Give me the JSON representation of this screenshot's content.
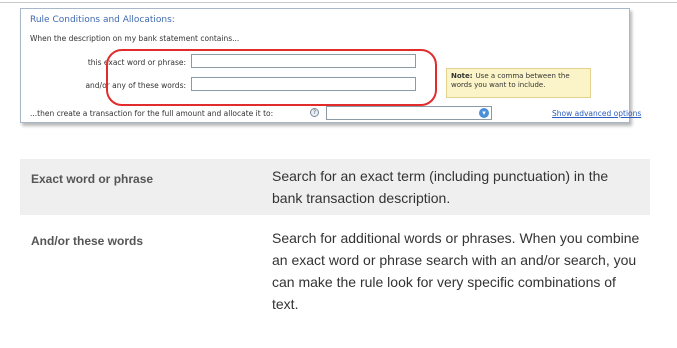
{
  "panel": {
    "heading": "Rule Conditions and Allocations:",
    "intro": "When the description on my bank statement contains...",
    "exact_label": "this exact word or phrase:",
    "any_label": "and/or any of these words:",
    "note_label": "Note:",
    "note_text": "Use a comma between the words you want to include.",
    "bottom_text": "...then create a transaction for the full amount and allocate it to:",
    "advanced_link": "Show advanced options",
    "highlight_color": "#e22b2b"
  },
  "definitions": [
    {
      "term": "Exact word or phrase",
      "description": "Search for an exact term (including punctuation) in the bank transaction description."
    },
    {
      "term": "And/or these words",
      "description": "Search for additional words or phrases. When you combine an exact word or phrase search with an and/or search, you can make the rule look for very specific combinations of text."
    }
  ]
}
